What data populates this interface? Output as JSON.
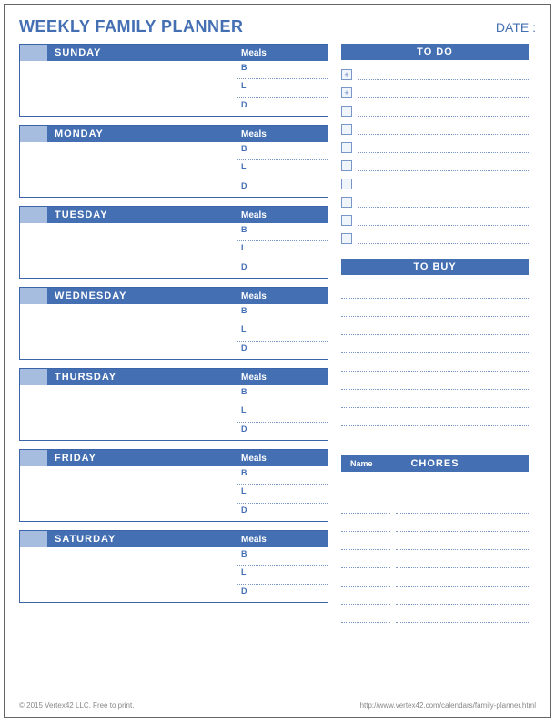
{
  "title": "WEEKLY FAMILY PLANNER",
  "date_label": "DATE :",
  "meals_header": "Meals",
  "meal_keys": [
    "B",
    "L",
    "D"
  ],
  "days": [
    "SUNDAY",
    "MONDAY",
    "TUESDAY",
    "WEDNESDAY",
    "THURSDAY",
    "FRIDAY",
    "SATURDAY"
  ],
  "sections": {
    "todo": "TO DO",
    "tobuy": "TO BUY",
    "chores": "CHORES",
    "chores_sub": "Name"
  },
  "todo_count": 10,
  "todo_plus_count": 2,
  "buy_lines": 9,
  "chore_lines": 8,
  "footer_left": "© 2015 Vertex42 LLC. Free to print.",
  "footer_right": "http://www.vertex42.com/calendars/family-planner.html"
}
